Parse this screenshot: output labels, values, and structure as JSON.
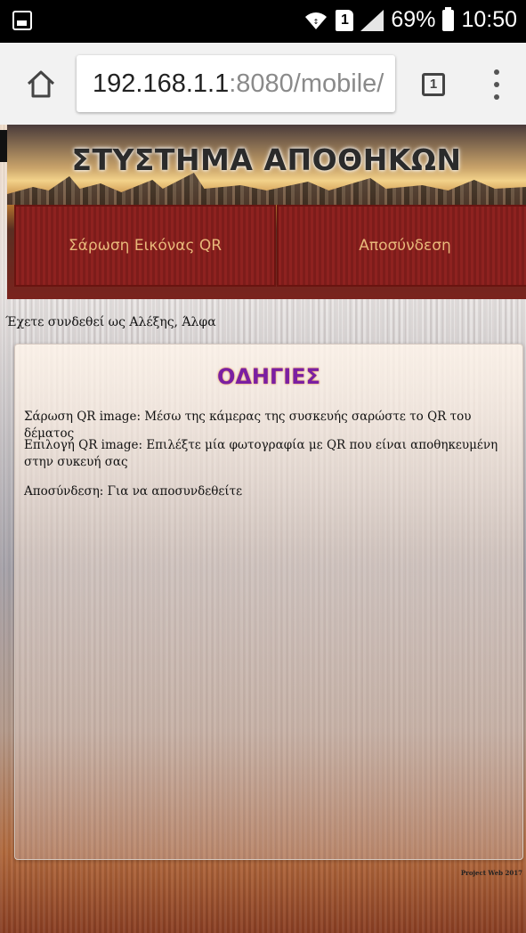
{
  "statusbar": {
    "battery_percent": "69%",
    "time": "10:50",
    "sim_slot": "1"
  },
  "browser": {
    "url_host": "192.168.1.1",
    "url_rest": ":8080/mobile/",
    "tab_count": "1"
  },
  "banner": {
    "title": "ΣΤΥΣΤΗΜΑ ΑΠΟΘΗΚΩΝ"
  },
  "nav": {
    "scan_label": "Σάρωση Εικόνας QR",
    "logout_label": "Αποσύνδεση"
  },
  "welcome": "Έχετε συνδεθεί ως Αλέξης, Άλφα",
  "instructions": {
    "title": "ΟΔΗΓΙΕΣ",
    "items": [
      "Σάρωση QR image: Μέσω της κάμερας της συσκευής σαρώστε το QR του δέματος",
      "Επιλογή QR image: Επιλέξτε μία φωτογραφία με QR που είναι αποθηκευμένη στην συκευή σας",
      "Αποσύνδεση: Για να αποσυνδεθείτε"
    ]
  },
  "footer": "Project Web 2017"
}
